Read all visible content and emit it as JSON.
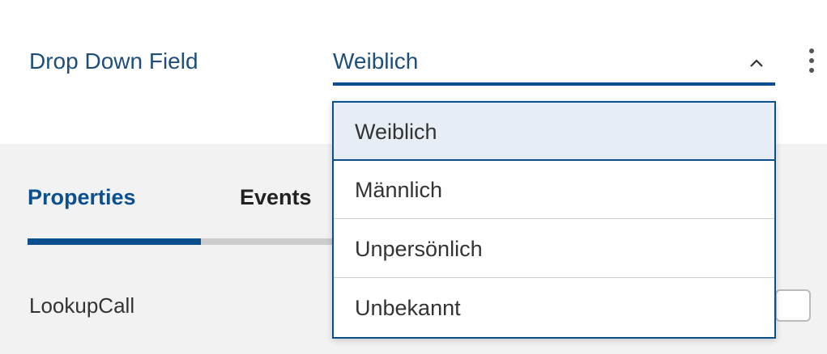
{
  "field": {
    "label": "Drop Down Field",
    "value": "Weiblich",
    "chevron_icon": "chevron-up-icon",
    "more_icon": "more-vertical-icon"
  },
  "tabs": [
    {
      "label": "Properties",
      "active": true
    },
    {
      "label": "Events",
      "active": false
    }
  ],
  "property": {
    "label": "LookupCall",
    "checked": false
  },
  "dropdown": {
    "options": [
      {
        "label": "Weiblich",
        "selected": true
      },
      {
        "label": "Männlich",
        "selected": false
      },
      {
        "label": "Unpersönlich",
        "selected": false
      },
      {
        "label": "Unbekannt",
        "selected": false
      }
    ]
  },
  "colors": {
    "accent": "#0a4f8e",
    "label_text": "#1f4e79",
    "selected_bg": "#e6edf5",
    "panel_bg": "#f2f2f2"
  }
}
